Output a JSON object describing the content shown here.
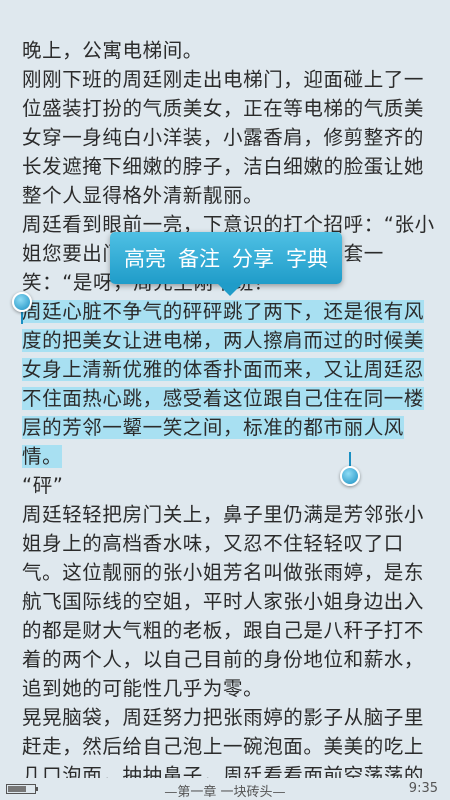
{
  "paragraphs": [
    "晚上，公寓电梯间。",
    "刚刚下班的周廷刚走出电梯门，迎面碰上了一位盛装打扮的气质美女，正在等电梯的气质美女穿一身纯白小洋装，小露香肩，修剪整齐的长发遮掩下细嫩的脖子，洁白细嫩的脸蛋让她整个人显得格外清新靓丽。",
    "周廷看到眼前一亮，下意识的打个招呼：“张小姐您要出门了，气质美女礼貌性的客套一笑：“是呀，周先生刚下班？”"
  ],
  "highlighted_paragraph": "周廷心脏不争气的砰砰跳了两下，还是很有风度的把美女让进电梯，两人擦肩而过的时候美女身上清新优雅的体香扑面而来，又让周廷忍不住面热心跳，感受着这位跟自己住在同一楼层的芳邻一颦一笑之间，标准的都市丽人风情。",
  "paragraphs_after": [
    "“砰”",
    "周廷轻轻把房门关上，鼻子里仍满是芳邻张小姐身上的高档香水味，又忍不住轻轻叹了口气。这位靓丽的张小姐芳名叫做张雨婷，是东航飞国际线的空姐，平时人家张小姐身边出入的都是财大气粗的老板，跟自己是八秆子打不着的两个人，以自己目前的身份地位和薪水，追到她的可能性几乎为零。",
    "晃晃脑袋，周廷努力把张雨婷的影子从脑子里赶走，然后给自己泡上一碗泡面。美美的吃上几口泡面，抽抽鼻子，周廷看看面前空荡荡的公寓房间"
  ],
  "popup": {
    "items": [
      "高亮",
      "备注",
      "分享",
      "字典"
    ]
  },
  "status": {
    "chapter": "—第一章 一块砖头—",
    "time": "9:35",
    "battery_level": 0.7
  }
}
